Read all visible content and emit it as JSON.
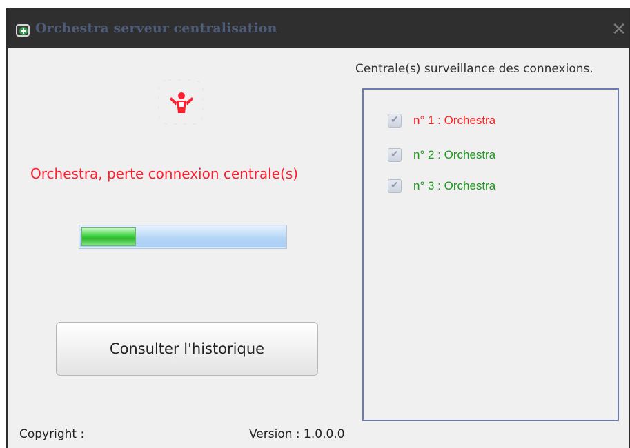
{
  "window": {
    "title": "Orchestra serveur centralisation",
    "close_symbol": "✕"
  },
  "status": {
    "message": "Orchestra, perte connexion centrale(s)",
    "icon": "person-alert-icon",
    "color": "#ff1e2e"
  },
  "progress": {
    "value_percent": 27
  },
  "actions": {
    "history_button": "Consulter l'historique"
  },
  "panel": {
    "label": "Centrale(s) surveillance des connexions.",
    "items": [
      {
        "label": "n° 1 : Orchestra",
        "checked": true,
        "status": "disconnected",
        "color": "#ff2020"
      },
      {
        "label": "n° 2 : Orchestra",
        "checked": true,
        "status": "connected",
        "color": "#1a9a1a"
      },
      {
        "label": "n° 3 : Orchestra",
        "checked": true,
        "status": "connected",
        "color": "#1a9a1a"
      }
    ]
  },
  "footer": {
    "copyright": "Copyright :",
    "version": "Version : 1.0.0.0"
  }
}
